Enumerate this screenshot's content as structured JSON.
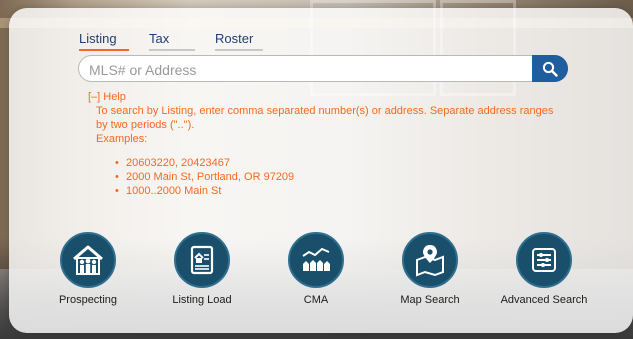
{
  "tabs": [
    {
      "label": "Listing",
      "active": true
    },
    {
      "label": "Tax",
      "active": false
    },
    {
      "label": "Roster",
      "active": false
    }
  ],
  "search": {
    "placeholder": "MLS# or Address",
    "value": ""
  },
  "help": {
    "toggle_label": "[–] Help",
    "text": "To search by Listing, enter comma separated number(s) or address. Separate address ranges by two periods (\"..\").",
    "examples_label": "Examples:",
    "examples": [
      "20603220, 20423467",
      "2000 Main St, Portland, OR 97209",
      "1000..2000 Main St"
    ]
  },
  "actions": [
    {
      "label": "Prospecting",
      "icon": "house-people-icon"
    },
    {
      "label": "Listing Load",
      "icon": "listing-document-icon"
    },
    {
      "label": "CMA",
      "icon": "cma-chart-houses-icon"
    },
    {
      "label": "Map Search",
      "icon": "map-pin-icon"
    },
    {
      "label": "Advanced Search",
      "icon": "sliders-icon"
    }
  ],
  "colors": {
    "accent": "#f26a21",
    "brand": "#1f5e9e",
    "icon_circle": "#1a4f6b",
    "tab_text": "#1f3f73"
  }
}
